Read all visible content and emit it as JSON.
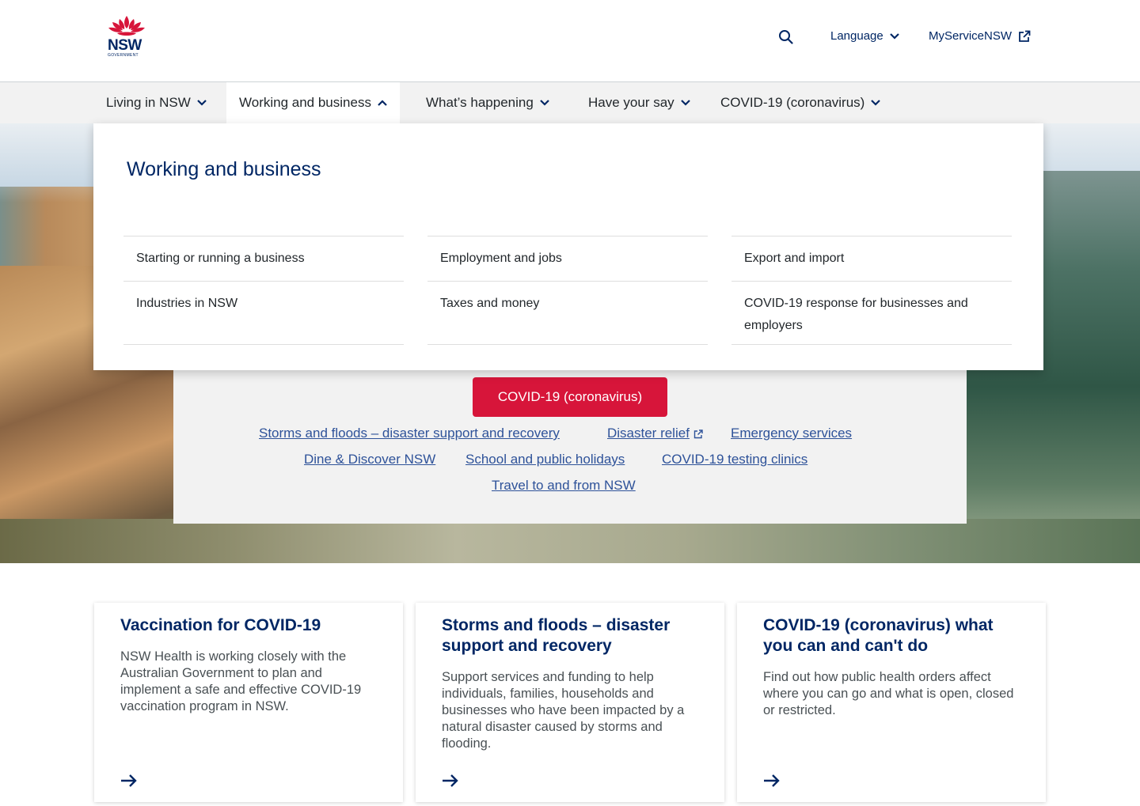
{
  "header": {
    "logo": {
      "text": "NSW",
      "subtext": "GOVERNMENT"
    },
    "language_label": "Language",
    "myservice_label": "MyServiceNSW"
  },
  "nav": {
    "items": [
      {
        "label": "Living in NSW",
        "expanded": false
      },
      {
        "label": "Working and business",
        "expanded": true
      },
      {
        "label": "What’s happening",
        "expanded": false
      },
      {
        "label": "Have your say",
        "expanded": false
      },
      {
        "label": "COVID-19 (coronavirus)",
        "expanded": false
      }
    ]
  },
  "dropdown": {
    "title": "Working and business",
    "columns": [
      [
        "Starting or running a business",
        "Industries in NSW"
      ],
      [
        "Employment and jobs",
        "Taxes and money"
      ],
      [
        "Export and import",
        "COVID-19 response for businesses and employers"
      ]
    ]
  },
  "hero": {
    "button_label": "COVID-19 (coronavirus)",
    "links": [
      "Storms and floods – disaster support and recovery",
      "Disaster relief",
      "Emergency services",
      "Dine & Discover NSW",
      "School and public holidays",
      "COVID-19 testing clinics",
      "Travel to and from NSW"
    ]
  },
  "cards": [
    {
      "title": "Vaccination for COVID-19",
      "body": "NSW Health is working closely with the Australian Government to plan and implement a safe and effective COVID-19 vaccination program in NSW."
    },
    {
      "title": "Storms and floods – disaster support and recovery",
      "body": "Support services and funding to help individuals, families, households and businesses who have been impacted by a natural disaster caused by storms and flooding."
    },
    {
      "title": "COVID-19 (coronavirus) what you can and can't do",
      "body": "Find out how public health orders affect where you can go and what is open, closed or restricted."
    }
  ],
  "colors": {
    "brand_navy": "#002664",
    "brand_red": "#d7153a",
    "link_blue": "#2e5299",
    "nav_bg": "#f2f2f2"
  }
}
